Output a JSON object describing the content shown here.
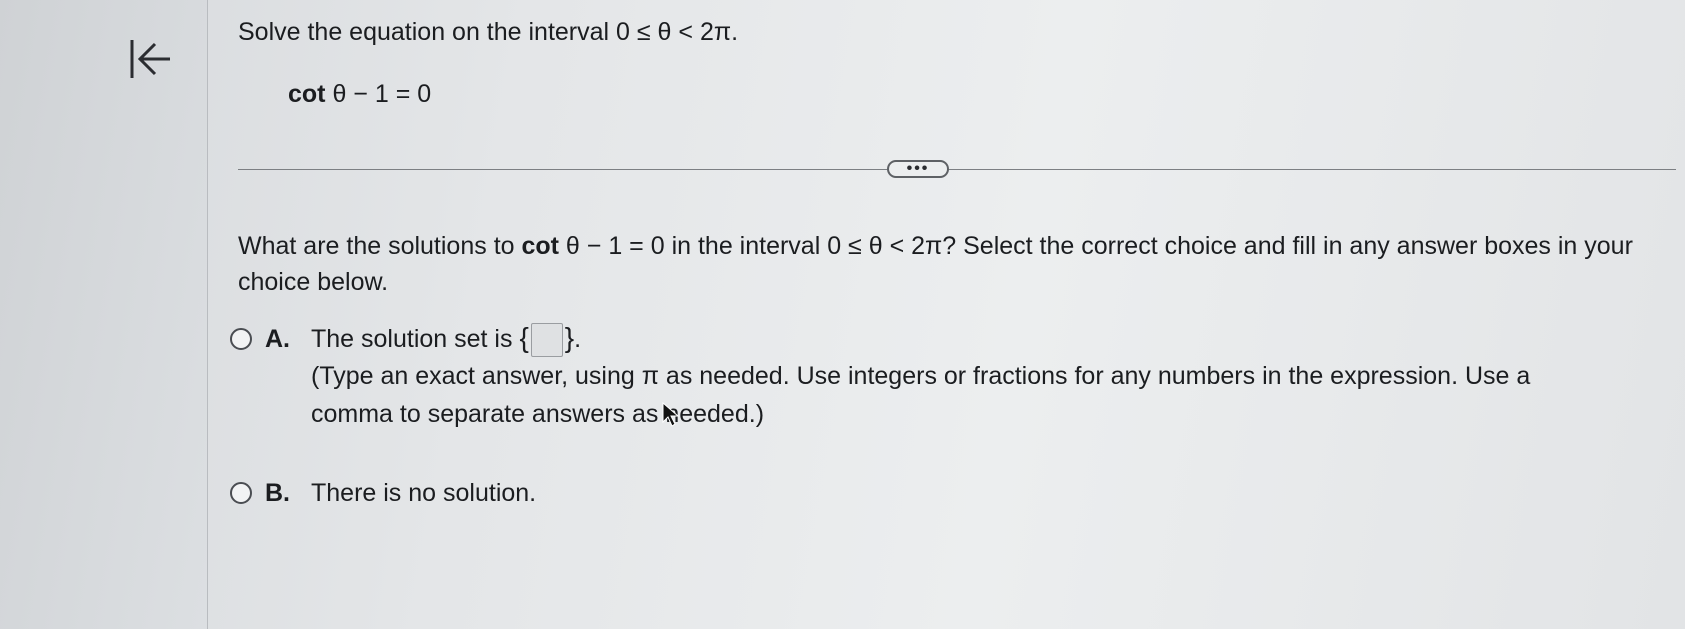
{
  "nav": {
    "back_icon": "skip-back-icon"
  },
  "question": {
    "title": "Solve the equation on the interval 0 ≤ θ < 2π.",
    "equation_func": "cot",
    "equation_rest": " θ − 1 = 0"
  },
  "expand": {
    "label": "•••"
  },
  "prompt": {
    "before": "What are the solutions to ",
    "func": "cot",
    "after": " θ − 1 = 0 in the interval 0 ≤ θ < 2π? Select the correct choice and fill in any answer boxes in your choice below."
  },
  "choices": {
    "a": {
      "letter": "A.",
      "text_before": "The solution set is ",
      "brace_open": "{",
      "brace_close": "}",
      "text_after": ".",
      "answer_value": "",
      "hint": "(Type an exact answer, using π as needed. Use integers or fractions for any numbers in the expression. Use a comma to separate answers as needed.)"
    },
    "b": {
      "letter": "B.",
      "text": "There is no solution."
    }
  }
}
